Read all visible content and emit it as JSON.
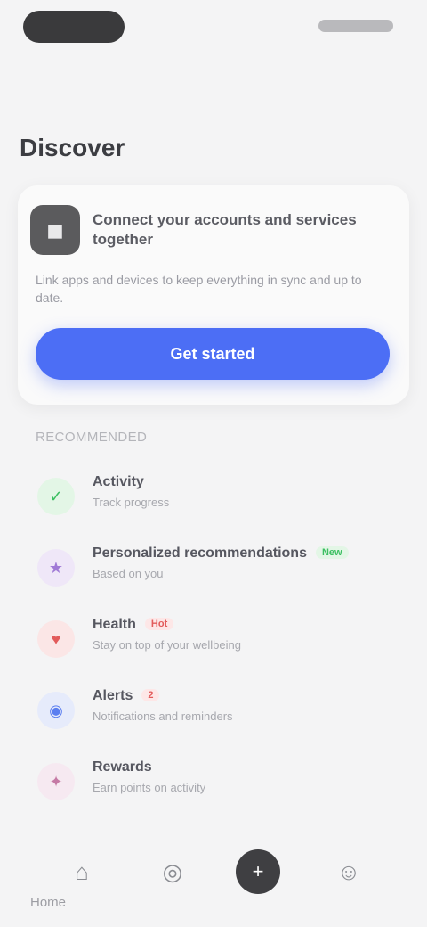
{
  "status_bar": {
    "left_pill": "",
    "right_indicators": ""
  },
  "page": {
    "title": "Discover"
  },
  "promo_card": {
    "avatar_glyph": "◼",
    "title": "Connect your accounts and services together",
    "description": "Link apps and devices to keep everything in sync and up to date.",
    "button_label": "Get started"
  },
  "section": {
    "label": "RECOMMENDED"
  },
  "items": [
    {
      "icon": "check-circle-icon",
      "glyph": "✓",
      "bg": "#e3f6e6",
      "fg": "#3cbf62",
      "title": "Activity",
      "subtitle": "Track progress",
      "badge": "",
      "badge_bg": "",
      "badge_fg": ""
    },
    {
      "icon": "star-icon",
      "glyph": "★",
      "bg": "#efe7f8",
      "fg": "#a07ad6",
      "title": "Personalized recommendations",
      "subtitle": "Based on you",
      "badge": "New",
      "badge_bg": "#e3f6e6",
      "badge_fg": "#3cbf62"
    },
    {
      "icon": "heart-icon",
      "glyph": "♥",
      "bg": "#fbe6e6",
      "fg": "#e25b5b",
      "title": "Health",
      "subtitle": "Stay on top of your wellbeing",
      "badge": "Hot",
      "badge_bg": "#fde7e7",
      "badge_fg": "#e25b5b"
    },
    {
      "icon": "bell-icon",
      "glyph": "◉",
      "bg": "#e6ebfb",
      "fg": "#5b7ef0",
      "title": "Alerts",
      "subtitle": "Notifications and reminders",
      "badge": "2",
      "badge_bg": "#fde7e7",
      "badge_fg": "#e25b5b"
    },
    {
      "icon": "gift-icon",
      "glyph": "✦",
      "bg": "#f6e9f1",
      "fg": "#c57aa5",
      "title": "Rewards",
      "subtitle": "Earn points on activity",
      "badge": "",
      "badge_bg": "",
      "badge_fg": ""
    }
  ],
  "tab_bar": {
    "tabs": [
      {
        "name": "tab-home",
        "icon": "home-icon",
        "glyph": "⌂"
      },
      {
        "name": "tab-explore",
        "icon": "compass-icon",
        "glyph": "◎"
      },
      {
        "name": "tab-center",
        "icon": "plus-icon",
        "glyph": "+"
      },
      {
        "name": "tab-profile",
        "icon": "person-icon",
        "glyph": "☺"
      }
    ],
    "bottom_label": "Home"
  },
  "colors": {
    "accent": "#4c6ef5",
    "background": "#f4f4f5"
  }
}
